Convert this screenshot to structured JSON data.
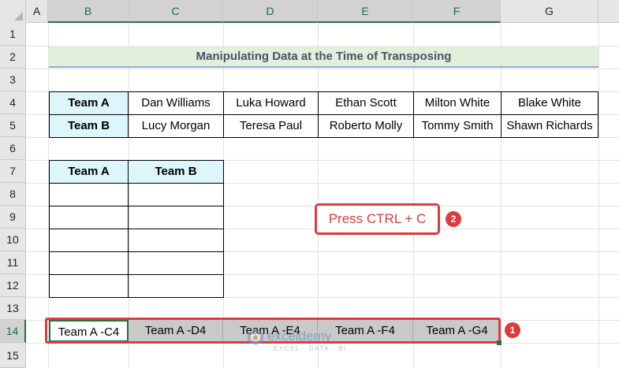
{
  "columns": [
    "A",
    "B",
    "C",
    "D",
    "E",
    "F",
    "G"
  ],
  "rows": [
    "1",
    "2",
    "3",
    "4",
    "5",
    "6",
    "7",
    "8",
    "9",
    "10",
    "11",
    "12",
    "13",
    "14",
    "15"
  ],
  "title": "Manipulating Data at the Time of Transposing",
  "team_table": {
    "rows": [
      {
        "label": "Team A",
        "members": [
          "Dan Williams",
          "Luka Howard",
          "Ethan Scott",
          "Milton White",
          "Blake White"
        ]
      },
      {
        "label": "Team B",
        "members": [
          "Lucy Morgan",
          "Teresa Paul",
          "Roberto Molly",
          "Tommy Smith",
          "Shawn Richards"
        ]
      }
    ]
  },
  "output_table": {
    "headers": [
      "Team A",
      "Team B"
    ]
  },
  "callout": {
    "text": "Press CTRL + C",
    "step": "2"
  },
  "copy_row": {
    "cells": [
      "Team A -C4",
      "Team A -D4",
      "Team A -E4",
      "Team A -F4",
      "Team A -G4"
    ],
    "step": "1"
  },
  "watermark": {
    "name": "exceldemy",
    "tagline": "EXCEL · DATA · BI"
  },
  "colors": {
    "accent": "#e03b3b",
    "excel_green": "#217346",
    "header_fill": "#ddf6fb",
    "title_fill": "#e2efda"
  }
}
